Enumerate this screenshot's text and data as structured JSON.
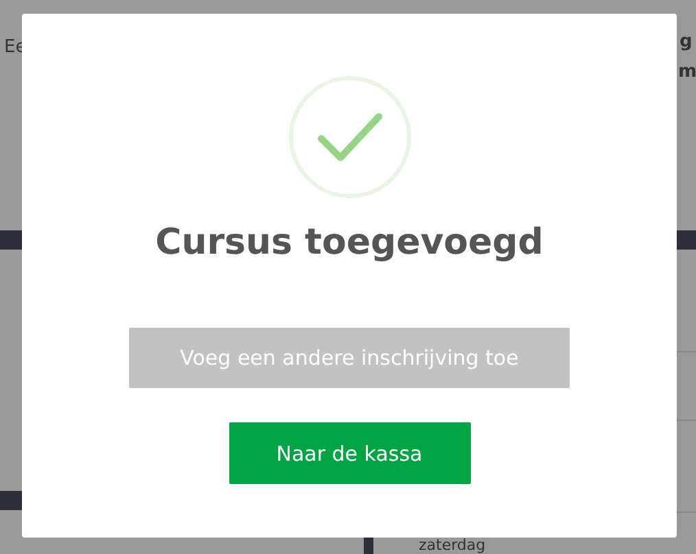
{
  "background": {
    "texts": [
      "Ee",
      "g",
      "m",
      "zaterdag"
    ]
  },
  "dialog": {
    "title": "Cursus toegevoegd",
    "buttons": [
      {
        "label": "Voeg een andere inschrijving toe",
        "kind": "secondary"
      },
      {
        "label": "Naar de kassa",
        "kind": "primary"
      }
    ]
  }
}
